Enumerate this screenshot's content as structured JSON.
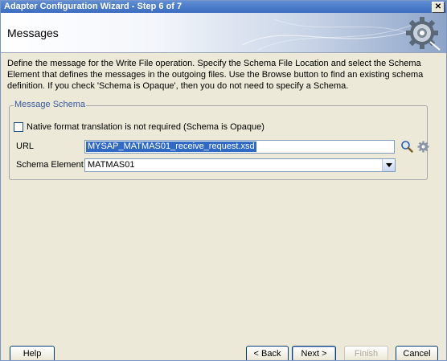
{
  "window": {
    "title": "Adapter Configuration Wizard - Step 6 of 7",
    "close_glyph": "✕"
  },
  "banner": {
    "heading": "Messages",
    "icon": "gear-icon"
  },
  "description": "Define the message for the Write File operation.  Specify the Schema File Location and select the Schema Element that defines the messages in the outgoing files. Use the Browse button to find an existing schema definition. If you check 'Schema is Opaque', then you do not need to specify a Schema.",
  "schema_group": {
    "legend": "Message Schema",
    "opaque_checkbox": {
      "label": "Native format translation is not required (Schema is Opaque)",
      "checked": false
    },
    "url": {
      "label": "URL",
      "value": "MYSAP_MATMAS01_receive_request.xsd",
      "browse_icon": "search-icon",
      "generate_icon": "gear-icon"
    },
    "schema_element": {
      "label": "Schema Element",
      "value": "MATMAS01"
    }
  },
  "buttons": {
    "help": "Help",
    "back": "< Back",
    "next": "Next >",
    "finish": "Finish",
    "cancel": "Cancel"
  }
}
